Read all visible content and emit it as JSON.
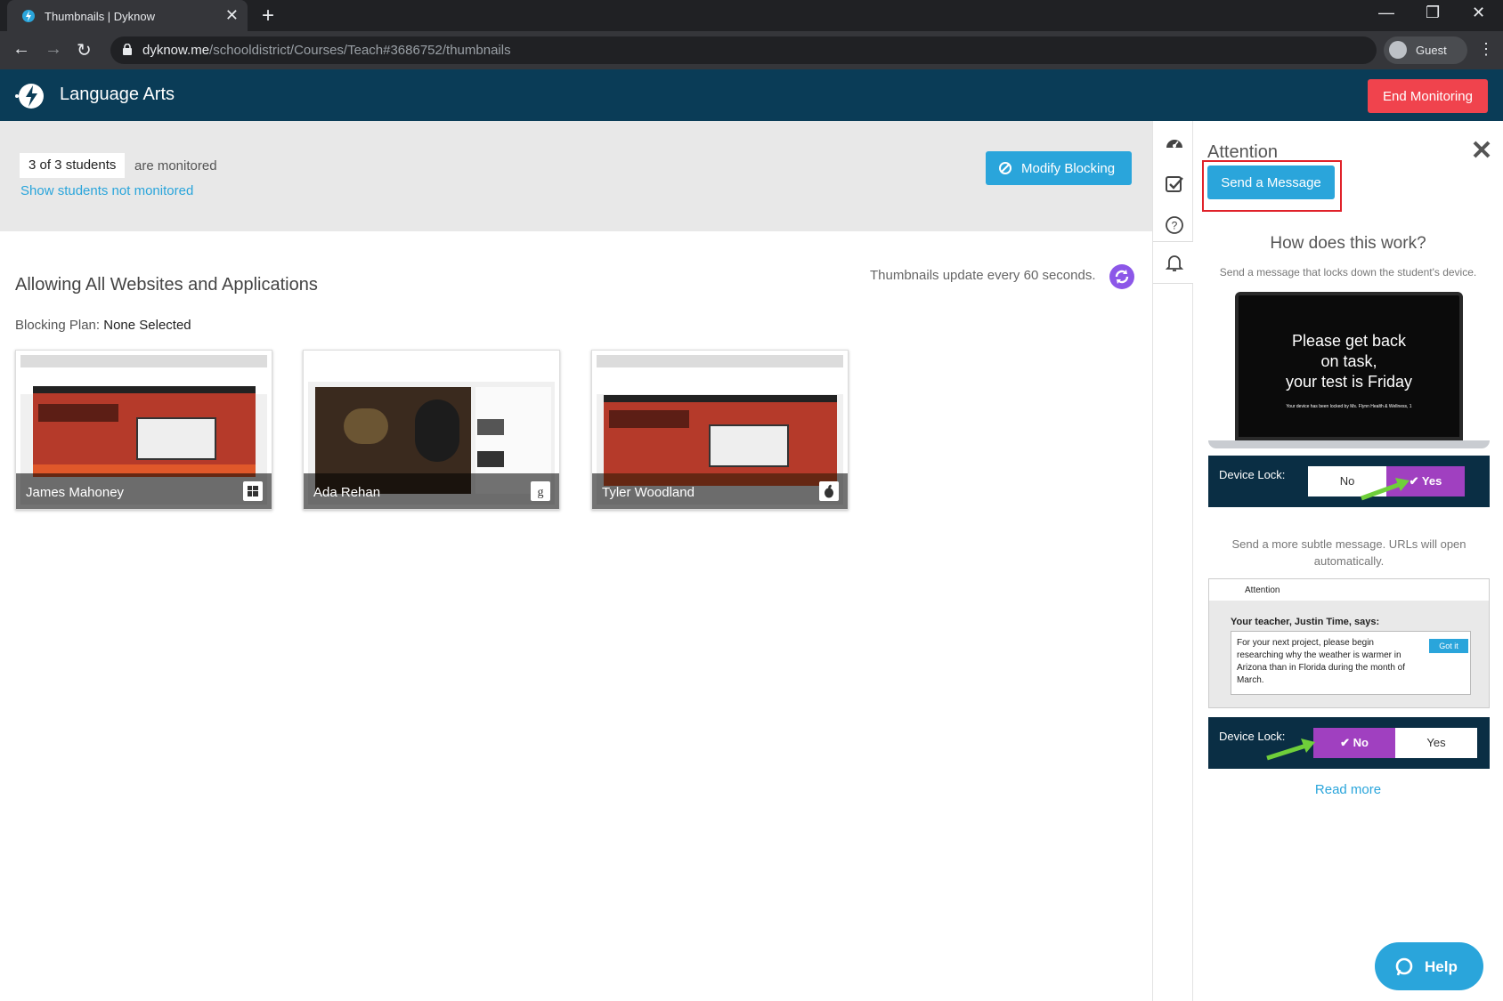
{
  "browser": {
    "tab_title": "Thumbnails | Dyknow",
    "tab_close": "✕",
    "new_tab": "+",
    "url_host": "dyknow.me",
    "url_path": "/schooldistrict/Courses/Teach#3686752/thumbnails",
    "profile_label": "Guest",
    "minimize": "—",
    "restore": "❐",
    "close": "✕",
    "back": "←",
    "forward": "→",
    "reload": "↻",
    "menu": "⋮"
  },
  "header": {
    "course_name": "Language Arts",
    "end_monitoring_label": "End Monitoring",
    "accent_color": "#0a3c57",
    "end_color": "#f0434d"
  },
  "monitor": {
    "count_label": "3 of 3 students",
    "count_suffix": "are monitored",
    "show_link": "Show students not monitored",
    "modify_blocking_label": "Modify Blocking"
  },
  "main": {
    "title": "Allowing All Websites and Applications",
    "update_text": "Thumbnails update every 60 seconds.",
    "plan_label": "Blocking Plan:",
    "plan_value": "None Selected"
  },
  "students": [
    {
      "name": "James Mahoney",
      "os": "windows-icon"
    },
    {
      "name": "Ada Rehan",
      "os": "chrome-os-icon"
    },
    {
      "name": "Tyler Woodland",
      "os": "apple-icon"
    }
  ],
  "panel": {
    "title": "Attention",
    "send_label": "Send a Message",
    "how_title": "How does this work?",
    "desc_lock": "Send a message that locks down the student's device.",
    "lock_message_line1": "Please get back",
    "lock_message_line2": "on task,",
    "lock_message_line3": "your test is Friday",
    "lock_small": "Your device has been locked by Ms. Flynn Health & Wellness, 1",
    "device_lock_label": "Device Lock:",
    "no_label": "No",
    "yes_label": "Yes",
    "yes_selected_label": "✔ Yes",
    "no_selected_label": "✔ No",
    "desc_subtle": "Send a more subtle message. URLs will open automatically.",
    "mock_window_title": "Attention",
    "mock_says": "Your teacher, Justin Time, says:",
    "mock_text": "For your next project, please begin researching why the weather is warmer in Arizona than in Florida during the month of March.",
    "mock_got_it": "Got it",
    "read_more": "Read more"
  },
  "help": {
    "label": "Help"
  }
}
